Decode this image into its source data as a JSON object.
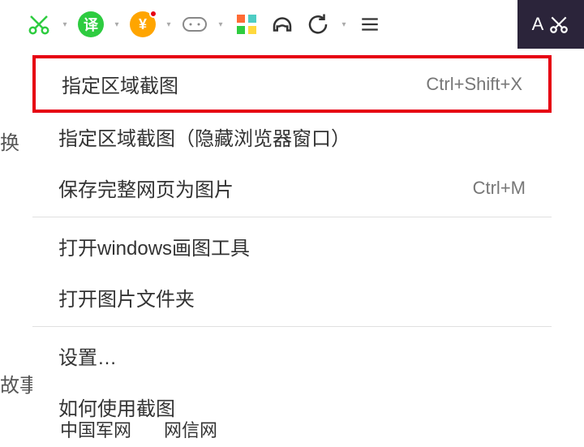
{
  "toolbar": {
    "translate_label": "译",
    "currency_label": "¥"
  },
  "dark_strip": {
    "label": "A"
  },
  "menu": {
    "item1": {
      "label": "指定区域截图",
      "shortcut": "Ctrl+Shift+X"
    },
    "item2": {
      "label": "指定区域截图（隐藏浏览器窗口）"
    },
    "item3": {
      "label": "保存完整网页为图片",
      "shortcut": "Ctrl+M"
    },
    "item4": {
      "label": "打开windows画图工具"
    },
    "item5": {
      "label": "打开图片文件夹"
    },
    "item6": {
      "label": "设置…"
    },
    "item7": {
      "label": "如何使用截图"
    }
  },
  "bg": {
    "text1": "换",
    "text2": "故事",
    "frag1": "中国军网",
    "frag2": "网信网"
  }
}
